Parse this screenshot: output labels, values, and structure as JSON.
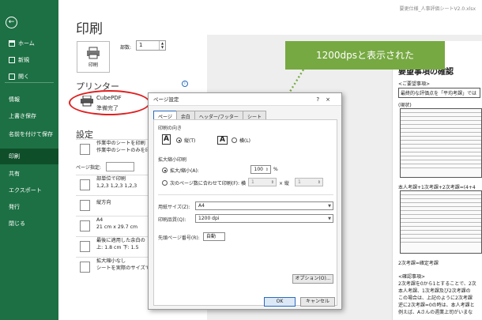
{
  "sidebar": {
    "back_icon": "←",
    "items": [
      {
        "label": "ホーム",
        "icon": "home-icon"
      },
      {
        "label": "新規",
        "icon": "new-icon"
      },
      {
        "label": "開く",
        "icon": "open-icon"
      },
      {
        "label": "情報"
      },
      {
        "label": "上書き保存"
      },
      {
        "label": "名前を付けて保存"
      },
      {
        "label": "印刷"
      },
      {
        "label": "共有"
      },
      {
        "label": "エクスポート"
      },
      {
        "label": "発行"
      },
      {
        "label": "閉じる"
      }
    ]
  },
  "main": {
    "title": "印刷",
    "filename": "要更仕様_人事評価シートV2.0.xlsx",
    "print_button": "印刷",
    "copies_label": "部数:",
    "copies_value": "1",
    "printer_header": "プリンター",
    "printer_name": "CubePDF",
    "printer_status": "準備完了",
    "info_icon": "i",
    "settings_header": "設定",
    "settings": [
      {
        "l1": "作業中のシートを印刷",
        "l2": "作業中のシートのみを印"
      },
      {
        "l1": "ページ指定:",
        "l2": ""
      },
      {
        "l1": "部単位で印刷",
        "l2": "1,2,3    1,2,3    1,2,3"
      },
      {
        "l1": "縦方向",
        "l2": ""
      },
      {
        "l1": "A4",
        "l2": "21 cm x 29.7 cm"
      },
      {
        "l1": "最後に適用した余白の",
        "l2": "上: 1.8 cm 下: 1.5"
      },
      {
        "l1": "拡大縮小なし",
        "l2": "シートを実際のサイズで"
      }
    ]
  },
  "callout": "1200dpsと表示された",
  "preview": {
    "title": "要望事項の確認",
    "lines": [
      "<ご要望事項>",
      "最終的な評価点を「平均考課」では",
      "(現状)",
      "本人考課+1次考課+2次考課=(4+4",
      "2次考課=確定考課",
      "<確認事項>",
      "2次考課を0から1とすることで、2次",
      "本人考課、1次考課及び2次考課の",
      "この場合は、上記のように2次考課",
      "逆に2次考課=0の時は、本人考課と",
      "例えば、Aさんの週業上司がいまな"
    ]
  },
  "dialog": {
    "title": "ページ設定",
    "help": "?",
    "close": "×",
    "tabs": [
      "ページ",
      "余白",
      "ヘッダー/フッター",
      "シート"
    ],
    "orientation_label": "印刷の向き",
    "portrait": "縦(T)",
    "landscape": "横(L)",
    "scaling_label": "拡大縮小印刷",
    "scale_option": "拡大/縮小(A):",
    "scale_value": "100",
    "percent": "%",
    "fit_option": "次のページ数に合わせて印刷(F): 横",
    "fit_w": "1",
    "fit_x": "× 縦",
    "fit_h": "1",
    "paper_label": "用紙サイズ(Z):",
    "paper_value": "A4",
    "quality_label": "印刷品質(Q):",
    "quality_value": "1200 dpi",
    "first_page_label": "先頭ページ番号(R):",
    "first_page_value": "自動",
    "options_button": "オプション(O)...",
    "ok": "OK",
    "cancel": "キャンセル"
  },
  "colors": {
    "sidebar": "#1d7044",
    "callout": "#77a942",
    "ring": "#e02020"
  }
}
